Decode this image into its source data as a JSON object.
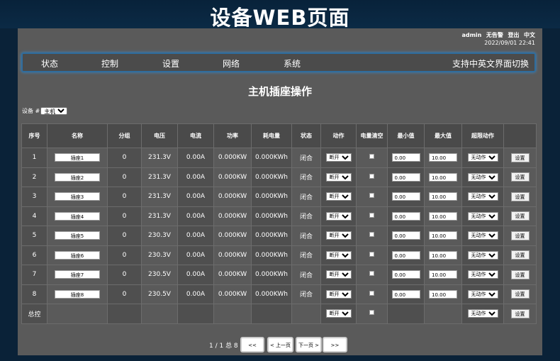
{
  "banner": {
    "title": "设备WEB页面"
  },
  "header": {
    "user": "admin",
    "alarm": "无告警",
    "logout": "登出",
    "lang": "中文",
    "datetime": "2022/09/01 22:41"
  },
  "nav": {
    "items": [
      "状态",
      "控制",
      "设置",
      "网络",
      "系统"
    ],
    "lang_switch": "支持中英文界面切换"
  },
  "page_title": "主机插座操作",
  "device": {
    "label": "设备 #",
    "value": "主机"
  },
  "table": {
    "headers": [
      "序号",
      "名称",
      "分组",
      "电压",
      "电流",
      "功率",
      "耗电量",
      "状态",
      "动作",
      "电量清空",
      "最小值",
      "最大值",
      "超限动作",
      ""
    ],
    "rows": [
      {
        "idx": "1",
        "name": "插座1",
        "group": "0",
        "voltage": "231.3V",
        "current": "0.00A",
        "power": "0.000KW",
        "energy": "0.000KWh",
        "status": "闭合",
        "action": "断开",
        "min": "0.00",
        "max": "10.00",
        "over_action": "无动作",
        "btn": "设置"
      },
      {
        "idx": "2",
        "name": "插座2",
        "group": "0",
        "voltage": "231.3V",
        "current": "0.00A",
        "power": "0.000KW",
        "energy": "0.000KWh",
        "status": "闭合",
        "action": "断开",
        "min": "0.00",
        "max": "10.00",
        "over_action": "无动作",
        "btn": "设置"
      },
      {
        "idx": "3",
        "name": "插座3",
        "group": "0",
        "voltage": "231.3V",
        "current": "0.00A",
        "power": "0.000KW",
        "energy": "0.000KWh",
        "status": "闭合",
        "action": "断开",
        "min": "0.00",
        "max": "10.00",
        "over_action": "无动作",
        "btn": "设置"
      },
      {
        "idx": "4",
        "name": "插座4",
        "group": "0",
        "voltage": "231.3V",
        "current": "0.00A",
        "power": "0.000KW",
        "energy": "0.000KWh",
        "status": "闭合",
        "action": "断开",
        "min": "0.00",
        "max": "10.00",
        "over_action": "无动作",
        "btn": "设置"
      },
      {
        "idx": "5",
        "name": "插座5",
        "group": "0",
        "voltage": "230.3V",
        "current": "0.00A",
        "power": "0.000KW",
        "energy": "0.000KWh",
        "status": "闭合",
        "action": "断开",
        "min": "0.00",
        "max": "10.00",
        "over_action": "无动作",
        "btn": "设置"
      },
      {
        "idx": "6",
        "name": "插座6",
        "group": "0",
        "voltage": "230.3V",
        "current": "0.00A",
        "power": "0.000KW",
        "energy": "0.000KWh",
        "status": "闭合",
        "action": "断开",
        "min": "0.00",
        "max": "10.00",
        "over_action": "无动作",
        "btn": "设置"
      },
      {
        "idx": "7",
        "name": "插座7",
        "group": "0",
        "voltage": "230.5V",
        "current": "0.00A",
        "power": "0.000KW",
        "energy": "0.000KWh",
        "status": "闭合",
        "action": "断开",
        "min": "0.00",
        "max": "10.00",
        "over_action": "无动作",
        "btn": "设置"
      },
      {
        "idx": "8",
        "name": "插座8",
        "group": "0",
        "voltage": "230.5V",
        "current": "0.00A",
        "power": "0.000KW",
        "energy": "0.000KWh",
        "status": "闭合",
        "action": "断开",
        "min": "0.00",
        "max": "10.00",
        "over_action": "无动作",
        "btn": "设置"
      }
    ],
    "total": {
      "label": "总控",
      "action": "断开",
      "over_action": "无动作",
      "btn": "设置"
    }
  },
  "pager": {
    "info": "1 / 1 总 8",
    "first": "<<",
    "prev": "< 上一页",
    "next": "下一页 >",
    "last": ">>"
  }
}
